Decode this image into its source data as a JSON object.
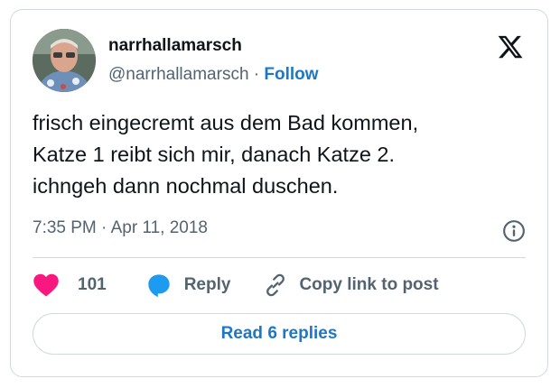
{
  "author": {
    "display_name": "narrhallamarsch",
    "handle": "@narrhallamarsch",
    "separator": "·",
    "follow_label": "Follow",
    "avatar": "profile-photo"
  },
  "tweet": {
    "lines": [
      "frisch eingecremt aus dem Bad kommen,",
      "Katze 1 reibt sich mir, danach Katze 2.",
      "ichngeh dann nochmal duschen."
    ],
    "timestamp": "7:35 PM · Apr 11, 2018"
  },
  "actions": {
    "like_count": "101",
    "reply_label": "Reply",
    "copy_link_label": "Copy link to post"
  },
  "footer": {
    "read_replies_label": "Read 6 replies"
  },
  "icons": {
    "logo": "x-logo-icon",
    "info": "info-icon",
    "like": "heart-icon",
    "reply": "reply-bubble-icon",
    "copy": "link-icon"
  },
  "colors": {
    "like": "#f91880",
    "reply": "#1d9bf0",
    "link_text": "#1d77c4",
    "secondary_text": "#536471",
    "border": "#cfd9de"
  }
}
